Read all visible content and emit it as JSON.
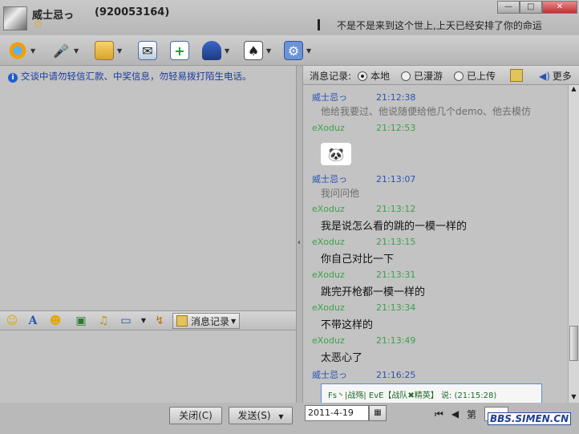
{
  "header": {
    "nickname": "威士忌っ",
    "qq_number": "(920053164)",
    "signature": "不是不是来到这个世上,上天已经安排了你的命运",
    "window_buttons": [
      "—",
      "□",
      "✕"
    ]
  },
  "notice": "交谈中请勿轻信汇款、中奖信息，勿轻易拨打陌生电话。",
  "history_header": {
    "label": "消息记录:",
    "options": [
      {
        "label": "本地",
        "selected": true
      },
      {
        "label": "已漫游",
        "selected": false
      },
      {
        "label": "已上传",
        "selected": false
      }
    ],
    "more": "更多"
  },
  "input_toolbar": {
    "history_button": "消息记录"
  },
  "messages": [
    {
      "sender": "威士忌っ",
      "time": "21:12:38",
      "type": "self",
      "text": "他给我要过、他说随便给他几个demo、他去模仿"
    },
    {
      "sender": "eXoduz",
      "time": "21:12:53",
      "type": "other",
      "text": ""
    },
    {
      "sender": "威士忌っ",
      "time": "21:13:07",
      "type": "self",
      "text": "我问问他"
    },
    {
      "sender": "eXoduz",
      "time": "21:13:12",
      "type": "other",
      "text": "我是说怎么看的跳的一模一样的"
    },
    {
      "sender": "eXoduz",
      "time": "21:13:15",
      "type": "other",
      "text": "你自己对比一下"
    },
    {
      "sender": "eXoduz",
      "time": "21:13:31",
      "type": "other",
      "text": "跳完开枪都一模一样的"
    },
    {
      "sender": "eXoduz",
      "time": "21:13:34",
      "type": "other",
      "text": "不带这样的"
    },
    {
      "sender": "eXoduz",
      "time": "21:13:49",
      "type": "other",
      "text": "太恶心了"
    },
    {
      "sender": "威士忌っ",
      "time": "21:16:25",
      "type": "self",
      "text": ""
    }
  ],
  "quote": "Fs丶|战殇|   EvE【战队✖精英】 说: (21:15:28)",
  "bottom": {
    "close_button": "关闭(C)",
    "send_button": "发送(S)",
    "date": "2011-4-19",
    "page_label": "第"
  },
  "watermark": "BBS.SIMEN.CN",
  "colors": {
    "self_name": "#2a53b5",
    "other_name": "#3aa24a",
    "notice": "#1c3aa0"
  }
}
